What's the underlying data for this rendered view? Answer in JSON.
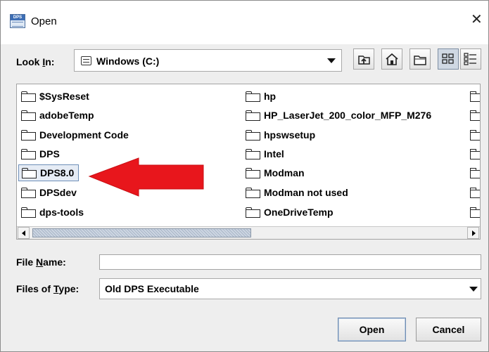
{
  "window": {
    "title": "Open",
    "app_icon_text": "DPS",
    "close_glyph": "✕"
  },
  "lookin": {
    "label": "Look In:",
    "label_mnemonic": "L",
    "value": "Windows (C:)",
    "value_icon": "drive-icon"
  },
  "toolbar": {
    "buttons": [
      {
        "name": "up-one-level-button",
        "icon": "folder-up-icon"
      },
      {
        "name": "home-button",
        "icon": "home-icon"
      },
      {
        "name": "new-folder-button",
        "icon": "new-folder-icon"
      },
      {
        "name": "list-view-button",
        "icon": "list-view-icon",
        "active": true
      },
      {
        "name": "details-view-button",
        "icon": "details-view-icon",
        "active": false
      }
    ]
  },
  "files": {
    "column1": [
      "$SysReset",
      "adobeTemp",
      "Development Code",
      "DPS",
      "DPS8.0",
      "DPSdev",
      "dps-tools"
    ],
    "column2": [
      "hp",
      "HP_LaserJet_200_color_MFP_M276",
      "hpswsetup",
      "Intel",
      "Modman",
      "Modman not used",
      "OneDriveTemp"
    ],
    "selected": "DPS8.0"
  },
  "annotation": {
    "arrow_color": "#e8161c",
    "points_to": "DPS8.0"
  },
  "filename": {
    "label": "File Name:",
    "value": ""
  },
  "filetype": {
    "label": "Files of Type:",
    "value": "Old DPS Executable"
  },
  "actions": {
    "open_label": "Open",
    "cancel_label": "Cancel"
  }
}
